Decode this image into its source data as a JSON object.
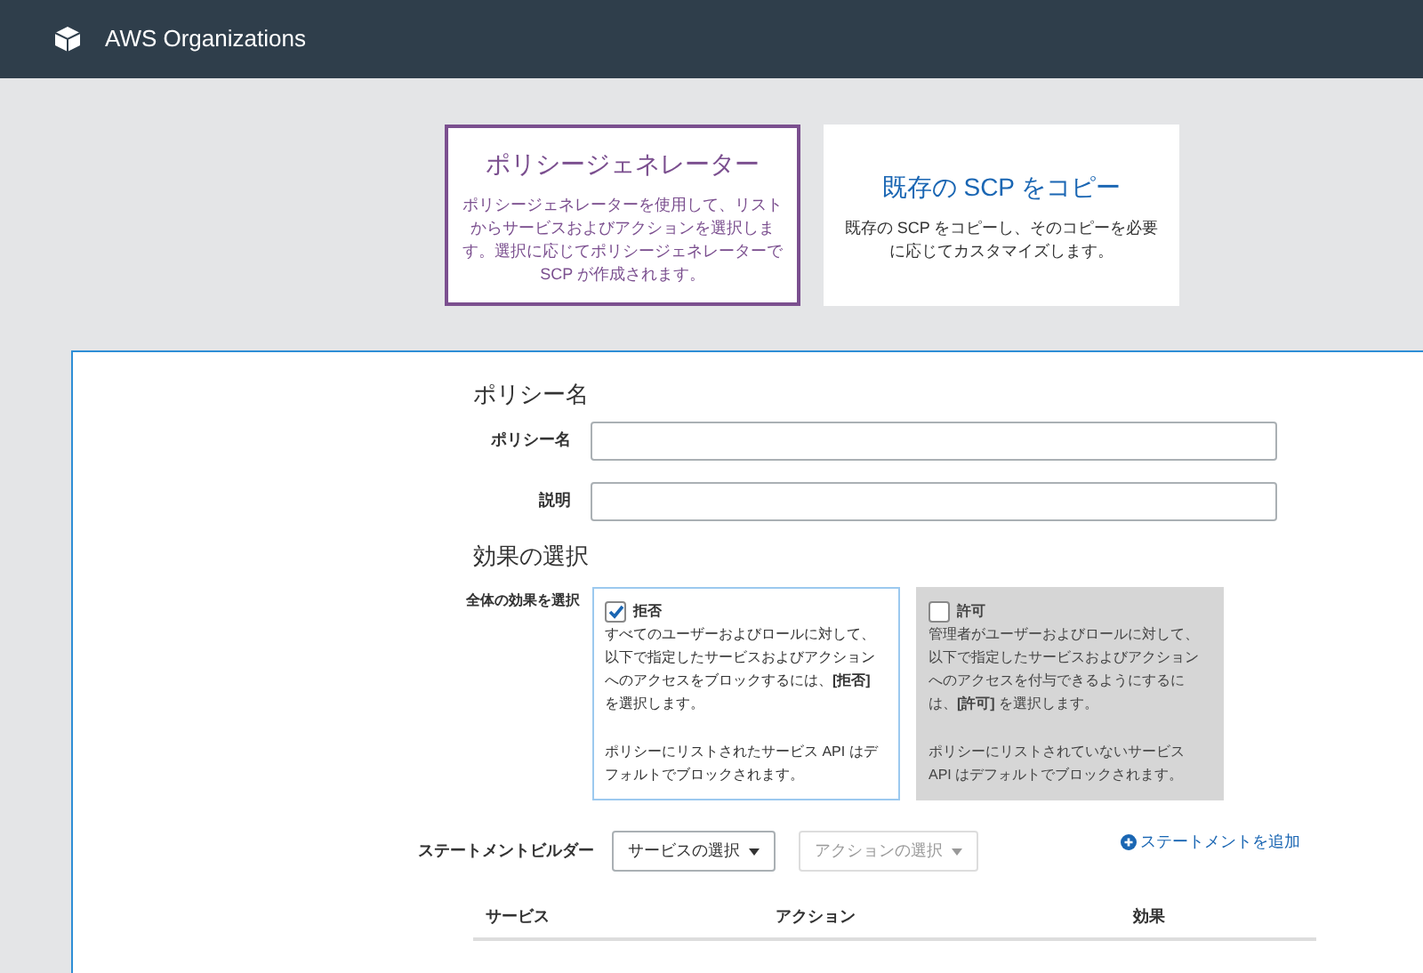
{
  "header": {
    "title": "AWS Organizations"
  },
  "options": [
    {
      "title": "ポリシージェネレーター",
      "description": "ポリシージェネレーターを使用して、リストからサービスおよびアクションを選択します。選択に応じてポリシージェネレーターで SCP が作成されます。",
      "selected": true
    },
    {
      "title": "既存の SCP をコピー",
      "description": "既存の SCP をコピーし、そのコピーを必要に応じてカスタマイズします。",
      "selected": false
    }
  ],
  "policy_section": {
    "heading": "ポリシー名",
    "fields": [
      {
        "label": "ポリシー名"
      },
      {
        "label": "説明"
      }
    ]
  },
  "effect_section": {
    "heading": "効果の選択",
    "label": "全体の効果を選択",
    "choices": [
      {
        "label": "拒否",
        "checked": true,
        "paragraphs": [
          "すべてのユーザーおよびロールに対して、以下で指定したサービスおよびアクションへのアクセスをブロックするには、**[拒否]** を選択します。",
          "ポリシーにリストされたサービス API はデフォルトでブロックされます。"
        ]
      },
      {
        "label": "許可",
        "checked": false,
        "paragraphs": [
          "管理者がユーザーおよびロールに対して、以下で指定したサービスおよびアクションへのアクセスを付与できるようにするには、**[許可]** を選択します。",
          "ポリシーにリストされていないサービス API はデフォルトでブロックされます。"
        ]
      }
    ]
  },
  "statement_builder": {
    "label": "ステートメントビルダー",
    "dropdowns": [
      {
        "label": "サービスの選択",
        "disabled": false
      },
      {
        "label": "アクションの選択",
        "disabled": true
      }
    ],
    "add_link": "ステートメントを追加"
  },
  "table": {
    "columns": [
      "サービス",
      "アクション",
      "効果"
    ]
  }
}
